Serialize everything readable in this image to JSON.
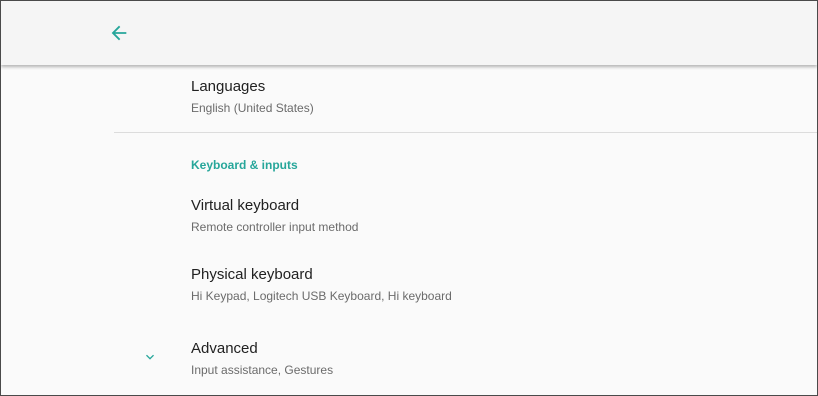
{
  "header": {
    "back_icon": "arrow-back-icon",
    "accent_color": "#26a69a"
  },
  "languages": {
    "title": "Languages",
    "summary": "English (United States)"
  },
  "keyboard_category": {
    "label": "Keyboard & inputs"
  },
  "virtual_keyboard": {
    "title": "Virtual keyboard",
    "summary": "Remote controller input method"
  },
  "physical_keyboard": {
    "title": "Physical keyboard",
    "summary": "Hi Keypad, Logitech USB Keyboard, Hi keyboard"
  },
  "advanced": {
    "icon": "chevron-down-icon",
    "title": "Advanced",
    "summary": "Input assistance, Gestures"
  }
}
